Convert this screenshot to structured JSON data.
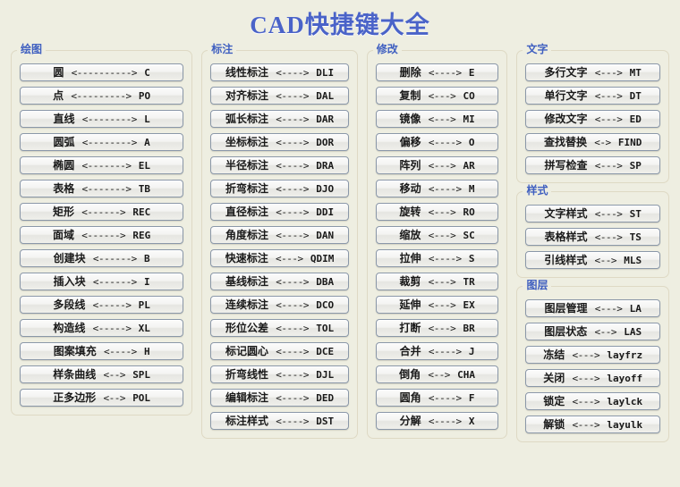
{
  "title": "CAD快捷键大全",
  "columns": [
    {
      "sections": [
        {
          "heading": "绘图",
          "items": [
            {
              "label": "圆",
              "arrow": "<---------->",
              "cmd": "C"
            },
            {
              "label": "点",
              "arrow": "<--------->",
              "cmd": "PO"
            },
            {
              "label": "直线",
              "arrow": "<-------->",
              "cmd": "L"
            },
            {
              "label": "圆弧",
              "arrow": "<-------->",
              "cmd": "A"
            },
            {
              "label": "椭圆",
              "arrow": "<------->",
              "cmd": "EL"
            },
            {
              "label": "表格",
              "arrow": "<------->",
              "cmd": "TB"
            },
            {
              "label": "矩形",
              "arrow": "<------>",
              "cmd": "REC"
            },
            {
              "label": "面域",
              "arrow": "<------>",
              "cmd": "REG"
            },
            {
              "label": "创建块",
              "arrow": "<------>",
              "cmd": "B"
            },
            {
              "label": "插入块",
              "arrow": "<------>",
              "cmd": "I"
            },
            {
              "label": "多段线",
              "arrow": "<----->",
              "cmd": "PL"
            },
            {
              "label": "构造线",
              "arrow": "<----->",
              "cmd": "XL"
            },
            {
              "label": "图案填充",
              "arrow": "<---->",
              "cmd": "H"
            },
            {
              "label": "样条曲线",
              "arrow": "<-->",
              "cmd": "SPL"
            },
            {
              "label": "正多边形",
              "arrow": "<-->",
              "cmd": "POL"
            }
          ]
        }
      ]
    },
    {
      "sections": [
        {
          "heading": "标注",
          "items": [
            {
              "label": "线性标注",
              "arrow": "<---->",
              "cmd": "DLI"
            },
            {
              "label": "对齐标注",
              "arrow": "<---->",
              "cmd": "DAL"
            },
            {
              "label": "弧长标注",
              "arrow": "<---->",
              "cmd": "DAR"
            },
            {
              "label": "坐标标注",
              "arrow": "<---->",
              "cmd": "DOR"
            },
            {
              "label": "半径标注",
              "arrow": "<---->",
              "cmd": "DRA"
            },
            {
              "label": "折弯标注",
              "arrow": "<---->",
              "cmd": "DJO"
            },
            {
              "label": "直径标注",
              "arrow": "<---->",
              "cmd": "DDI"
            },
            {
              "label": "角度标注",
              "arrow": "<---->",
              "cmd": "DAN"
            },
            {
              "label": "快速标注",
              "arrow": "<--->",
              "cmd": "QDIM"
            },
            {
              "label": "基线标注",
              "arrow": "<---->",
              "cmd": "DBA"
            },
            {
              "label": "连续标注",
              "arrow": "<---->",
              "cmd": "DCO"
            },
            {
              "label": "形位公差",
              "arrow": "<---->",
              "cmd": "TOL"
            },
            {
              "label": "标记圆心",
              "arrow": "<---->",
              "cmd": "DCE"
            },
            {
              "label": "折弯线性",
              "arrow": "<---->",
              "cmd": "DJL"
            },
            {
              "label": "编辑标注",
              "arrow": "<---->",
              "cmd": "DED"
            },
            {
              "label": "标注样式",
              "arrow": "<---->",
              "cmd": "DST"
            }
          ]
        }
      ]
    },
    {
      "sections": [
        {
          "heading": "修改",
          "items": [
            {
              "label": "删除",
              "arrow": "<---->",
              "cmd": "E"
            },
            {
              "label": "复制",
              "arrow": "<--->",
              "cmd": "CO"
            },
            {
              "label": "镜像",
              "arrow": "<--->",
              "cmd": "MI"
            },
            {
              "label": "偏移",
              "arrow": "<---->",
              "cmd": "O"
            },
            {
              "label": "阵列",
              "arrow": "<--->",
              "cmd": "AR"
            },
            {
              "label": "移动",
              "arrow": "<---->",
              "cmd": "M"
            },
            {
              "label": "旋转",
              "arrow": "<--->",
              "cmd": "RO"
            },
            {
              "label": "缩放",
              "arrow": "<--->",
              "cmd": "SC"
            },
            {
              "label": "拉伸",
              "arrow": "<---->",
              "cmd": "S"
            },
            {
              "label": "裁剪",
              "arrow": "<--->",
              "cmd": "TR"
            },
            {
              "label": "延伸",
              "arrow": "<--->",
              "cmd": "EX"
            },
            {
              "label": "打断",
              "arrow": "<--->",
              "cmd": "BR"
            },
            {
              "label": "合并",
              "arrow": "<---->",
              "cmd": "J"
            },
            {
              "label": "倒角",
              "arrow": "<-->",
              "cmd": "CHA"
            },
            {
              "label": "圆角",
              "arrow": "<---->",
              "cmd": "F"
            },
            {
              "label": "分解",
              "arrow": "<---->",
              "cmd": "X"
            }
          ]
        }
      ]
    },
    {
      "sections": [
        {
          "heading": "文字",
          "items": [
            {
              "label": "多行文字",
              "arrow": "<--->",
              "cmd": "MT"
            },
            {
              "label": "单行文字",
              "arrow": "<--->",
              "cmd": "DT"
            },
            {
              "label": "修改文字",
              "arrow": "<--->",
              "cmd": "ED"
            },
            {
              "label": "查找替换",
              "arrow": "<->",
              "cmd": "FIND"
            },
            {
              "label": "拼写检查",
              "arrow": "<--->",
              "cmd": "SP"
            }
          ]
        },
        {
          "heading": "样式",
          "items": [
            {
              "label": "文字样式",
              "arrow": "<--->",
              "cmd": "ST"
            },
            {
              "label": "表格样式",
              "arrow": "<--->",
              "cmd": "TS"
            },
            {
              "label": "引线样式",
              "arrow": "<-->",
              "cmd": "MLS"
            }
          ]
        },
        {
          "heading": "图层",
          "items": [
            {
              "label": "图层管理",
              "arrow": "<--->",
              "cmd": "LA"
            },
            {
              "label": "图层状态",
              "arrow": "<-->",
              "cmd": "LAS"
            },
            {
              "label": "冻结",
              "arrow": "<--->",
              "cmd": "layfrz"
            },
            {
              "label": "关闭",
              "arrow": "<--->",
              "cmd": "layoff"
            },
            {
              "label": "锁定",
              "arrow": "<--->",
              "cmd": "laylck"
            },
            {
              "label": "解锁",
              "arrow": "<--->",
              "cmd": "layulk"
            }
          ]
        }
      ]
    }
  ],
  "colors": {
    "background": "#eeeee1",
    "title": "#4a63c8",
    "section_heading": "#3f5fc0",
    "panel_border": "#ded9c4",
    "item_border": "#8a97a8"
  }
}
